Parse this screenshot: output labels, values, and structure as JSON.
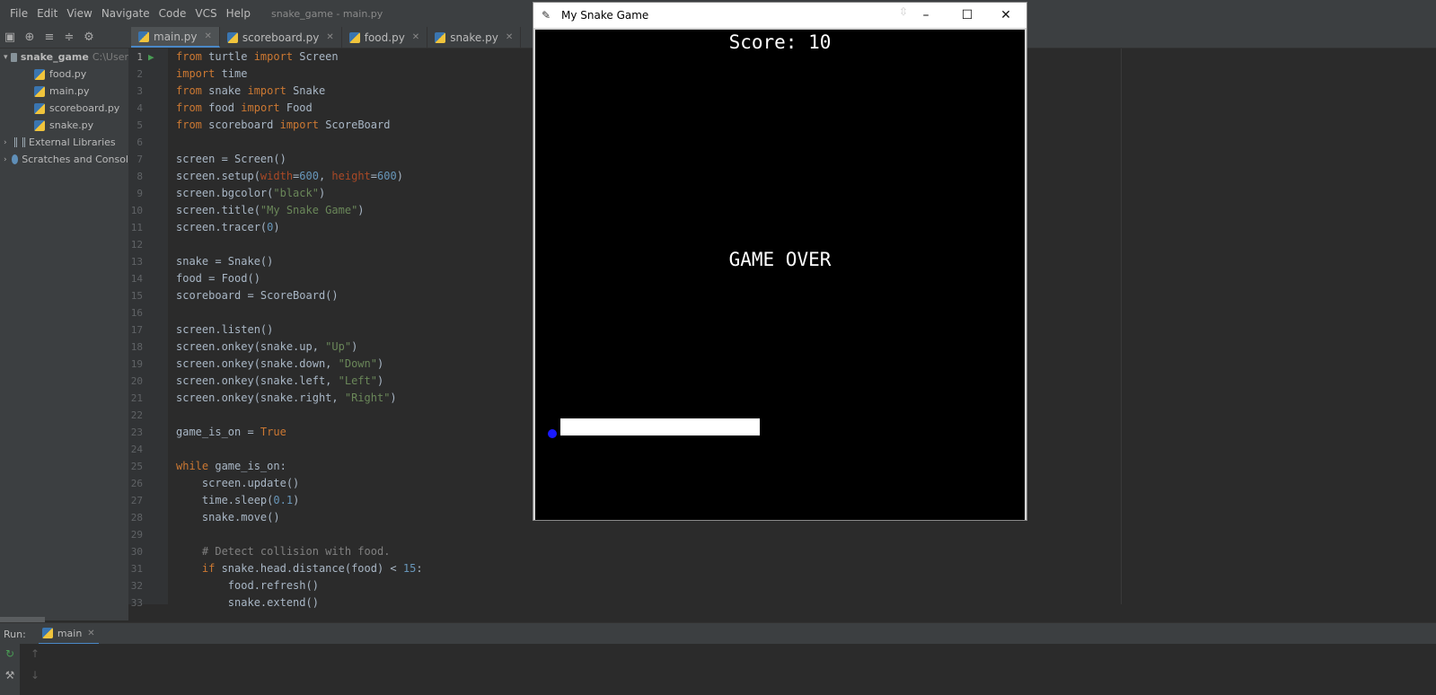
{
  "menu": {
    "items": [
      "File",
      "Edit",
      "View",
      "Navigate",
      "Code",
      "VCS",
      "Help"
    ],
    "window_title": "snake_game - main.py"
  },
  "tabs": [
    {
      "label": "main.py",
      "active": true
    },
    {
      "label": "scoreboard.py",
      "active": false
    },
    {
      "label": "food.py",
      "active": false
    },
    {
      "label": "snake.py",
      "active": false
    }
  ],
  "project": {
    "root": "snake_game",
    "root_path": "C:\\User",
    "files": [
      "food.py",
      "main.py",
      "scoreboard.py",
      "snake.py"
    ],
    "external": "External Libraries",
    "scratches": "Scratches and Consol"
  },
  "editor": {
    "line_numbers": [
      "1",
      "2",
      "3",
      "4",
      "5",
      "6",
      "7",
      "8",
      "9",
      "10",
      "11",
      "12",
      "13",
      "14",
      "15",
      "16",
      "17",
      "18",
      "19",
      "20",
      "21",
      "22",
      "23",
      "24",
      "25",
      "26",
      "27",
      "28",
      "29",
      "30",
      "31",
      "32",
      "33"
    ]
  },
  "run": {
    "label": "Run:",
    "tab": "main"
  },
  "game": {
    "window_title": "My Snake Game",
    "score_text": "Score: 10",
    "game_over_text": "GAME OVER",
    "background_color": "#000000",
    "text_color": "#ffffff",
    "food_color": "#1a1aff"
  }
}
